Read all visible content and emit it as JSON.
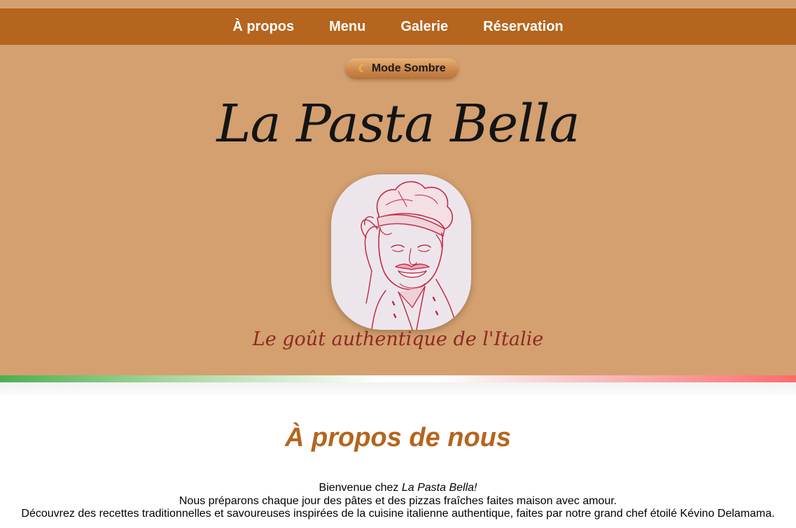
{
  "nav": {
    "items": [
      {
        "label": "À propos"
      },
      {
        "label": "Menu"
      },
      {
        "label": "Galerie"
      },
      {
        "label": "Réservation"
      }
    ]
  },
  "mode_toggle": {
    "label": "Mode Sombre",
    "icon": "moon-icon"
  },
  "hero": {
    "title": "La Pasta Bella",
    "tagline": "Le goût authentique de l'Italie"
  },
  "about": {
    "title": "À propos de nous",
    "line1_prefix": "Bienvenue chez ",
    "line1_name": "La Pasta Bella!",
    "line2": "Nous préparons chaque jour des pâtes et des pizzas fraîches faites maison avec amour.",
    "line3": "Découvrez des recettes traditionnelles et savoureuses inspirées de la cuisine italienne authentique, faites par notre grand chef étoilé Kévino Delamama."
  },
  "colors": {
    "nav_bg": "#b5651d",
    "hero_bg": "#d4a06f",
    "accent": "#b5651d",
    "tagline": "#8b2a22",
    "flag_green": "#4caf50",
    "flag_red": "#ff6b6b"
  }
}
